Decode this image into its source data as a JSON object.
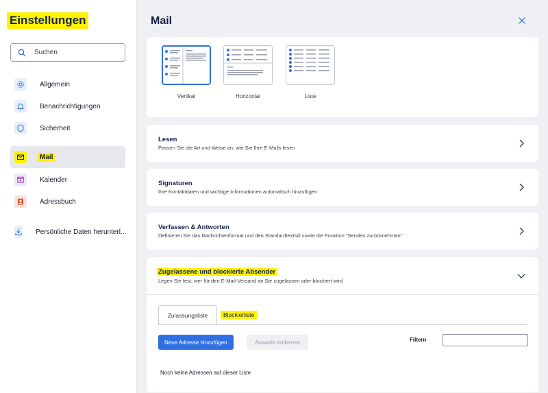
{
  "sidebar": {
    "title": "Einstellungen",
    "search_placeholder": "Suchen",
    "items": [
      {
        "label": "Allgemein",
        "icon": "gear-icon"
      },
      {
        "label": "Benachrichtigungen",
        "icon": "bell-icon"
      },
      {
        "label": "Sicherheit",
        "icon": "shield-icon"
      },
      {
        "label": "Mail",
        "icon": "mail-icon",
        "active": true
      },
      {
        "label": "Kalender",
        "icon": "calendar-icon"
      },
      {
        "label": "Adressbuch",
        "icon": "address-book-icon"
      },
      {
        "label": "Persönliche Daten herunterl...",
        "icon": "download-icon"
      }
    ]
  },
  "main": {
    "title": "Mail",
    "layouts": [
      {
        "label": "Vertikal",
        "selected": true
      },
      {
        "label": "Horizontal"
      },
      {
        "label": "Liste"
      }
    ],
    "sections": [
      {
        "title": "Lesen",
        "desc": "Passen Sie die Art und Weise an, wie Sie Ihre E-Mails lesen"
      },
      {
        "title": "Signaturen",
        "desc": "Ihre Kontaktdaten und wichtige Informationen automatisch hinzufügen"
      },
      {
        "title": "Verfassen & Antworten",
        "desc": "Definieren Sie das Nachrichtenformat und den Standardtextstil sowie die Funktion \"Senden zurücknehmen\""
      }
    ],
    "senders": {
      "title": "Zugelassene und blockierte Absender",
      "desc": "Legen Sie fest, wer für den E-Mail-Versand an Sie zugelassen oder blockiert wird",
      "tabs": [
        "Zulassungsliste",
        "Blockierliste"
      ],
      "add_button": "Neue Adresse hinzufügen",
      "remove_button": "Auswahl entfernen",
      "filter_label": "Filtern",
      "filter_value": "",
      "empty_text": "Noch keine Adressen auf dieser Liste"
    }
  },
  "colors": {
    "accent": "#2f6fe4",
    "highlight": "#fff200",
    "heading": "#14224a",
    "panel_bg": "#eef0f3"
  }
}
